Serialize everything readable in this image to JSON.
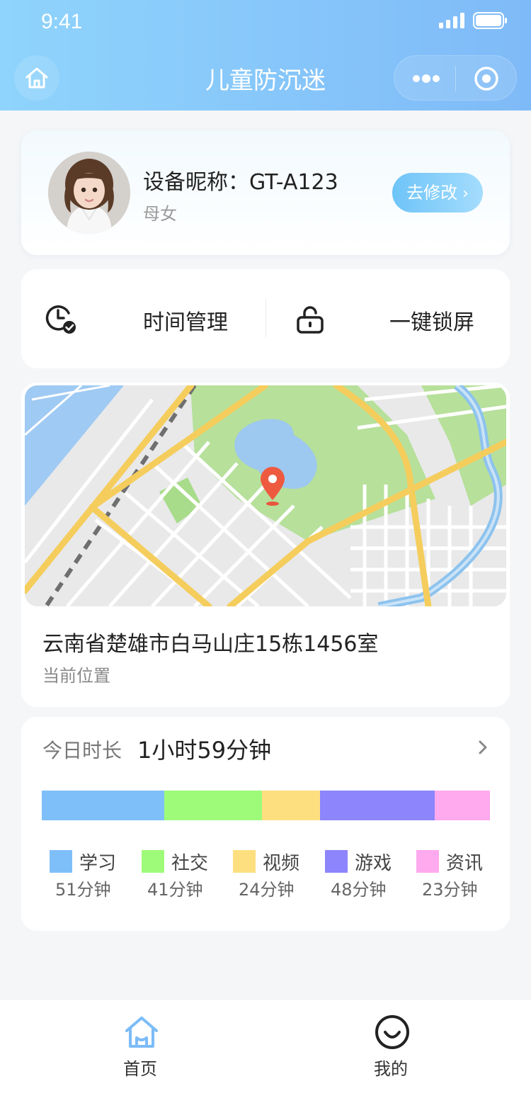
{
  "status_bar": {
    "time": "9:41"
  },
  "nav": {
    "title": "儿童防沉迷",
    "home_icon": "home-icon",
    "more_icon": "more-dots-icon",
    "close_icon": "target-icon"
  },
  "profile": {
    "nickname": "设备昵称：GT-A123",
    "relation": "母女",
    "edit_label": "去修改"
  },
  "actions": [
    {
      "label": "时间管理",
      "icon": "clock-check-icon"
    },
    {
      "label": "一键锁屏",
      "icon": "unlock-icon"
    }
  ],
  "location": {
    "address": "云南省楚雄市白马山庄15栋1456室",
    "subtitle": "当前位置",
    "pin_icon": "location-pin-icon"
  },
  "usage": {
    "label": "今日时长",
    "total": "1小时59分钟",
    "categories": [
      {
        "name": "学习",
        "value": "51分钟",
        "minutes": 51,
        "color": "#7fbff9"
      },
      {
        "name": "社交",
        "value": "41分钟",
        "minutes": 41,
        "color": "#9efb7a"
      },
      {
        "name": "视频",
        "value": "24分钟",
        "minutes": 24,
        "color": "#fedf80"
      },
      {
        "name": "游戏",
        "value": "48分钟",
        "minutes": 48,
        "color": "#8c85fb"
      },
      {
        "name": "资讯",
        "value": "23分钟",
        "minutes": 23,
        "color": "#ffa9ef"
      }
    ]
  },
  "tabbar": [
    {
      "label": "首页",
      "icon": "home-tab-icon",
      "active": true
    },
    {
      "label": "我的",
      "icon": "smiley-icon",
      "active": false
    }
  ]
}
